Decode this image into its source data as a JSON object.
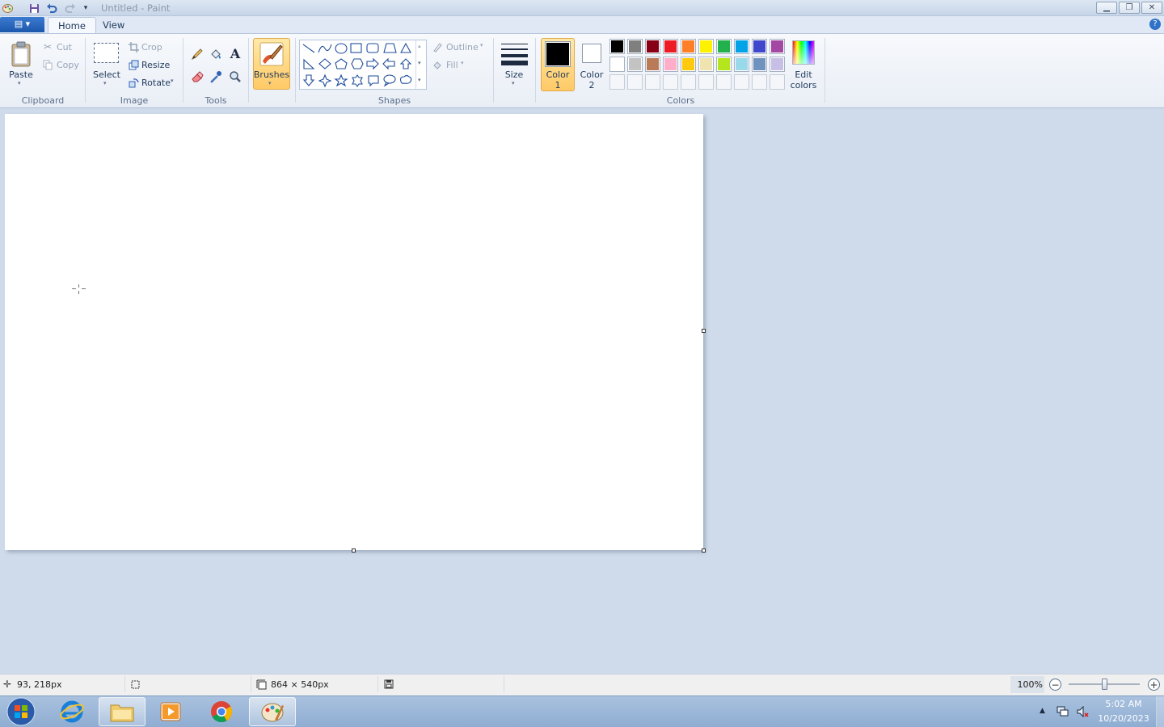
{
  "window": {
    "title": "Untitled - Paint"
  },
  "tabs": {
    "app_menu": "▤ ▾",
    "home": "Home",
    "view": "View",
    "help": "?"
  },
  "ribbon": {
    "clipboard": {
      "paste": "Paste",
      "cut": "Cut",
      "copy": "Copy",
      "group": "Clipboard"
    },
    "image": {
      "select": "Select",
      "crop": "Crop",
      "resize": "Resize",
      "rotate": "Rotate",
      "group": "Image"
    },
    "tools": {
      "group": "Tools"
    },
    "brushes": {
      "label": "Brushes"
    },
    "shapes": {
      "outline": "Outline",
      "fill": "Fill",
      "group": "Shapes"
    },
    "size": {
      "label": "Size"
    },
    "colors": {
      "color1_a": "Color",
      "color1_b": "1",
      "color2_a": "Color",
      "color2_b": "2",
      "edit_a": "Edit",
      "edit_b": "colors",
      "group": "Colors",
      "color1": "#000000",
      "color2": "#ffffff",
      "palette_row1": [
        "#000000",
        "#7f7f7f",
        "#880015",
        "#ed1c24",
        "#ff7f27",
        "#fff200",
        "#22b14c",
        "#00a2e8",
        "#3f48cc",
        "#a349a4"
      ],
      "palette_row2": [
        "#ffffff",
        "#c3c3c3",
        "#b97a57",
        "#ffaec9",
        "#ffc90e",
        "#efe4b0",
        "#b5e61d",
        "#99d9ea",
        "#7092be",
        "#c8bfe7"
      ]
    }
  },
  "status": {
    "cursor_pos": "93, 218px",
    "image_size": "864 × 540px",
    "zoom": "100%"
  },
  "taskbar": {
    "time": "5:02 AM",
    "date": "10/20/2023"
  }
}
